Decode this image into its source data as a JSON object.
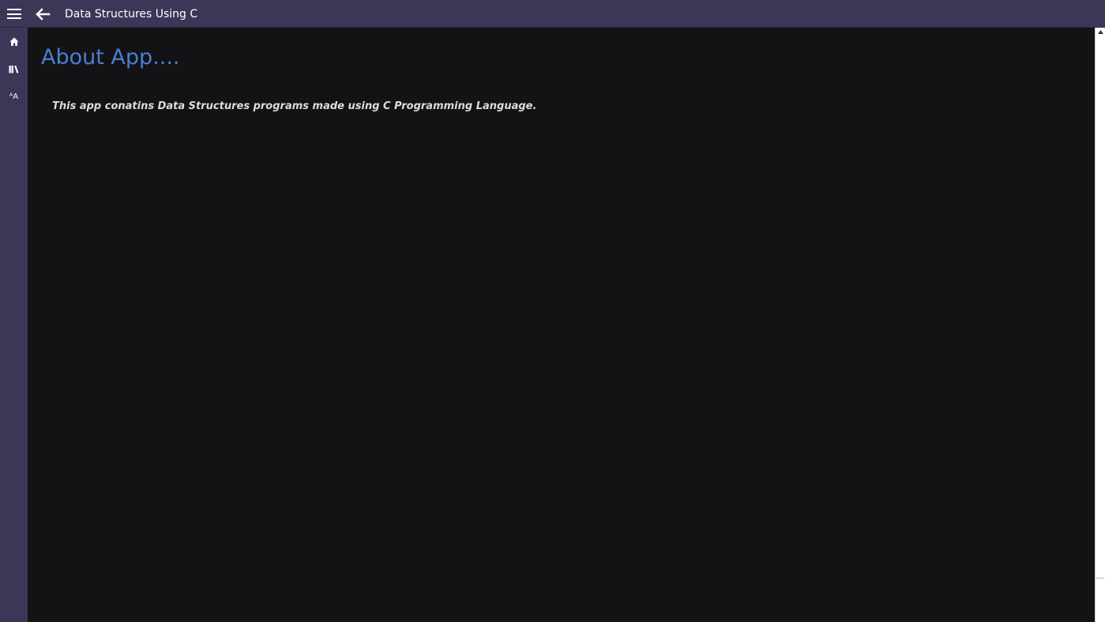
{
  "titlebar": {
    "title": "Data Structures Using C",
    "menu_icon": "hamburger-menu-icon",
    "back_icon": "back-arrow-icon"
  },
  "sidebar": {
    "items": [
      {
        "icon": "home-icon"
      },
      {
        "icon": "library-icon"
      },
      {
        "icon": "font-size-icon",
        "glyph": "ᴬA"
      }
    ]
  },
  "main": {
    "heading": "About App....",
    "description": "This app conatins Data Structures programs made using C Programming Language."
  },
  "colors": {
    "chrome": "#3b3757",
    "background": "#131316",
    "heading": "#4a7fd0",
    "text": "#dcdcdc"
  }
}
